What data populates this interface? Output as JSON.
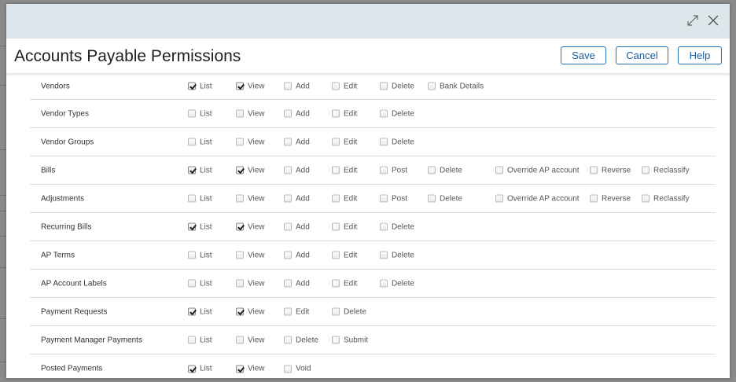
{
  "window": {
    "title": "Accounts Payable Permissions",
    "expand_icon": "expand-icon",
    "close_icon": "close-icon"
  },
  "actions": {
    "save_label": "Save",
    "cancel_label": "Cancel",
    "help_label": "Help"
  },
  "colors": {
    "accent": "#1f6fb5",
    "bar": "#dde6ea"
  },
  "rows": [
    {
      "label": "Vendors",
      "perms": [
        {
          "label": "List",
          "checked": true
        },
        {
          "label": "View",
          "checked": true
        },
        {
          "label": "Add",
          "checked": false
        },
        {
          "label": "Edit",
          "checked": false
        },
        {
          "label": "Delete",
          "checked": false
        },
        {
          "label": "Bank Details",
          "checked": false
        }
      ]
    },
    {
      "label": "Vendor Types",
      "perms": [
        {
          "label": "List",
          "checked": false
        },
        {
          "label": "View",
          "checked": false
        },
        {
          "label": "Add",
          "checked": false
        },
        {
          "label": "Edit",
          "checked": false
        },
        {
          "label": "Delete",
          "checked": false
        }
      ]
    },
    {
      "label": "Vendor Groups",
      "perms": [
        {
          "label": "List",
          "checked": false
        },
        {
          "label": "View",
          "checked": false
        },
        {
          "label": "Add",
          "checked": false
        },
        {
          "label": "Edit",
          "checked": false
        },
        {
          "label": "Delete",
          "checked": false
        }
      ]
    },
    {
      "label": "Bills",
      "perms": [
        {
          "label": "List",
          "checked": true
        },
        {
          "label": "View",
          "checked": true
        },
        {
          "label": "Add",
          "checked": false
        },
        {
          "label": "Edit",
          "checked": false
        },
        {
          "label": "Post",
          "checked": false
        },
        {
          "label": "Delete",
          "checked": false
        },
        {
          "label": "Override AP account",
          "checked": false
        },
        {
          "label": "Reverse",
          "checked": false
        },
        {
          "label": "Reclassify",
          "checked": false
        }
      ]
    },
    {
      "label": "Adjustments",
      "perms": [
        {
          "label": "List",
          "checked": false
        },
        {
          "label": "View",
          "checked": false
        },
        {
          "label": "Add",
          "checked": false
        },
        {
          "label": "Edit",
          "checked": false
        },
        {
          "label": "Post",
          "checked": false
        },
        {
          "label": "Delete",
          "checked": false
        },
        {
          "label": "Override AP account",
          "checked": false
        },
        {
          "label": "Reverse",
          "checked": false
        },
        {
          "label": "Reclassify",
          "checked": false
        }
      ]
    },
    {
      "label": "Recurring Bills",
      "perms": [
        {
          "label": "List",
          "checked": true
        },
        {
          "label": "View",
          "checked": true
        },
        {
          "label": "Add",
          "checked": false
        },
        {
          "label": "Edit",
          "checked": false
        },
        {
          "label": "Delete",
          "checked": false
        }
      ]
    },
    {
      "label": "AP Terms",
      "perms": [
        {
          "label": "List",
          "checked": false
        },
        {
          "label": "View",
          "checked": false
        },
        {
          "label": "Add",
          "checked": false
        },
        {
          "label": "Edit",
          "checked": false
        },
        {
          "label": "Delete",
          "checked": false
        }
      ]
    },
    {
      "label": "AP Account Labels",
      "perms": [
        {
          "label": "List",
          "checked": false
        },
        {
          "label": "View",
          "checked": false
        },
        {
          "label": "Add",
          "checked": false
        },
        {
          "label": "Edit",
          "checked": false
        },
        {
          "label": "Delete",
          "checked": false
        }
      ]
    },
    {
      "label": "Payment Requests",
      "perms": [
        {
          "label": "List",
          "checked": true
        },
        {
          "label": "View",
          "checked": true
        },
        {
          "label": "Edit",
          "checked": false
        },
        {
          "label": "Delete",
          "checked": false
        }
      ]
    },
    {
      "label": "Payment Manager Payments",
      "perms": [
        {
          "label": "List",
          "checked": false
        },
        {
          "label": "View",
          "checked": false
        },
        {
          "label": "Delete",
          "checked": false
        },
        {
          "label": "Submit",
          "checked": false
        }
      ]
    },
    {
      "label": "Posted Payments",
      "perms": [
        {
          "label": "List",
          "checked": true
        },
        {
          "label": "View",
          "checked": true
        },
        {
          "label": "Void",
          "checked": false
        }
      ]
    }
  ]
}
